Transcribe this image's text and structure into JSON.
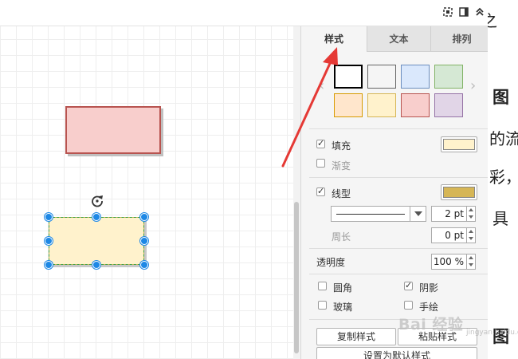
{
  "toolbar": {
    "icons": [
      "fit-icon",
      "panel-icon",
      "collapse-icon"
    ]
  },
  "tabs": [
    {
      "label": "样式",
      "active": true
    },
    {
      "label": "文本",
      "active": false
    },
    {
      "label": "排列",
      "active": false
    }
  ],
  "swatches": [
    {
      "fill": "#ffffff",
      "stroke": "#000000"
    },
    {
      "fill": "#f5f5f5",
      "stroke": "#666666"
    },
    {
      "fill": "#dae8fc",
      "stroke": "#6c8ebf"
    },
    {
      "fill": "#d5e8d4",
      "stroke": "#82b366"
    },
    {
      "fill": "#ffe6cc",
      "stroke": "#d79b00"
    },
    {
      "fill": "#fff2cc",
      "stroke": "#d6b656"
    },
    {
      "fill": "#f8cecc",
      "stroke": "#b85450"
    },
    {
      "fill": "#e1d5e7",
      "stroke": "#9673a6"
    }
  ],
  "style": {
    "fill": {
      "label": "填充",
      "checked": true,
      "color": "#fff2cc"
    },
    "gradient": {
      "label": "渐变",
      "checked": false
    },
    "line": {
      "label": "线型",
      "checked": true,
      "color": "#d6b656",
      "width": "2 pt"
    },
    "perimeter": {
      "label": "周长",
      "value": "0 pt"
    },
    "opacity": {
      "label": "透明度",
      "value": "100 %"
    },
    "rounded": {
      "label": "圆角",
      "checked": false
    },
    "shadow": {
      "label": "阴影",
      "checked": true
    },
    "glass": {
      "label": "玻璃",
      "checked": false
    },
    "sketch": {
      "label": "手绘",
      "checked": false
    }
  },
  "buttons": {
    "copy_style": "复制样式",
    "paste_style": "粘贴样式",
    "set_default": "设置为默认样式"
  },
  "shapes": {
    "red": {
      "fill": "#f8cecc",
      "stroke": "#b85450"
    },
    "yellow": {
      "fill": "#fff2cc",
      "stroke": "#d6b656"
    }
  },
  "background_text": [
    "之",
    "图",
    "的流",
    "彩，",
    "具",
    "图"
  ],
  "watermark": {
    "main": "Bai 经验",
    "sub": "jingyan.baidu.com"
  },
  "annotation_color": "#e53935"
}
